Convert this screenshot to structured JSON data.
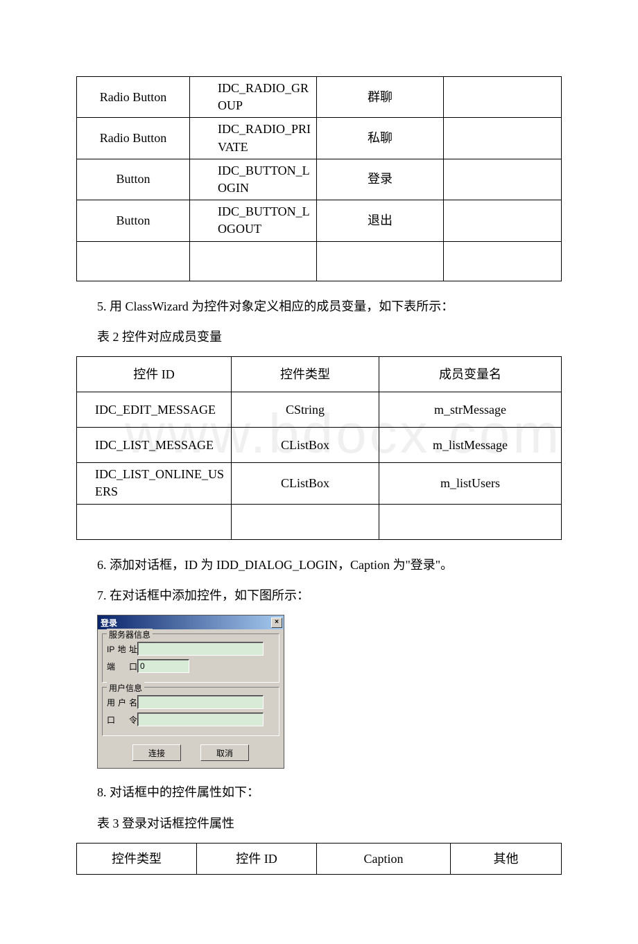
{
  "table1": {
    "rows": [
      {
        "type": "Radio Button",
        "id": "IDC_RADIO_GROUP",
        "caption": "群聊",
        "other": ""
      },
      {
        "type": "Radio Button",
        "id": "IDC_RADIO_PRIVATE",
        "caption": "私聊",
        "other": ""
      },
      {
        "type": "Button",
        "id": "IDC_BUTTON_LOGIN",
        "caption": "登录",
        "other": ""
      },
      {
        "type": "Button",
        "id": "IDC_BUTTON_LOGOUT",
        "caption": "退出",
        "other": ""
      }
    ]
  },
  "para5": "5. 用 ClassWizard 为控件对象定义相应的成员变量，如下表所示：",
  "table2_caption": "表 2 控件对应成员变量",
  "table2": {
    "headers": {
      "h1": "控件 ID",
      "h2": "控件类型",
      "h3": "成员变量名"
    },
    "rows": [
      {
        "id": "IDC_EDIT_MESSAGE",
        "type": "CString",
        "var": "m_strMessage"
      },
      {
        "id": "IDC_LIST_MESSAGE",
        "type": "CListBox",
        "var": "m_listMessage"
      },
      {
        "id": "IDC_LIST_ONLINE_USERS",
        "type": "CListBox",
        "var": "m_listUsers"
      }
    ]
  },
  "para6": "6. 添加对话框，ID 为 IDD_DIALOG_LOGIN，Caption 为\"登录\"。",
  "para7": "7. 在对话框中添加控件，如下图所示：",
  "dialog": {
    "title": "登录",
    "group1": "服务器信息",
    "ip_label": "IP地址",
    "port_label": "端口",
    "port_value": "0",
    "group2": "用户信息",
    "user_label": "用户名",
    "pwd_label": "口令",
    "btn_connect": "连接",
    "btn_cancel": "取消"
  },
  "para8": "8. 对话框中的控件属性如下：",
  "table3_caption": "表 3 登录对话框控件属性",
  "table3": {
    "headers": {
      "h1": "控件类型",
      "h2": "控件 ID",
      "h3": "Caption",
      "h4": "其他"
    }
  },
  "watermark": "www.bdocx.com"
}
